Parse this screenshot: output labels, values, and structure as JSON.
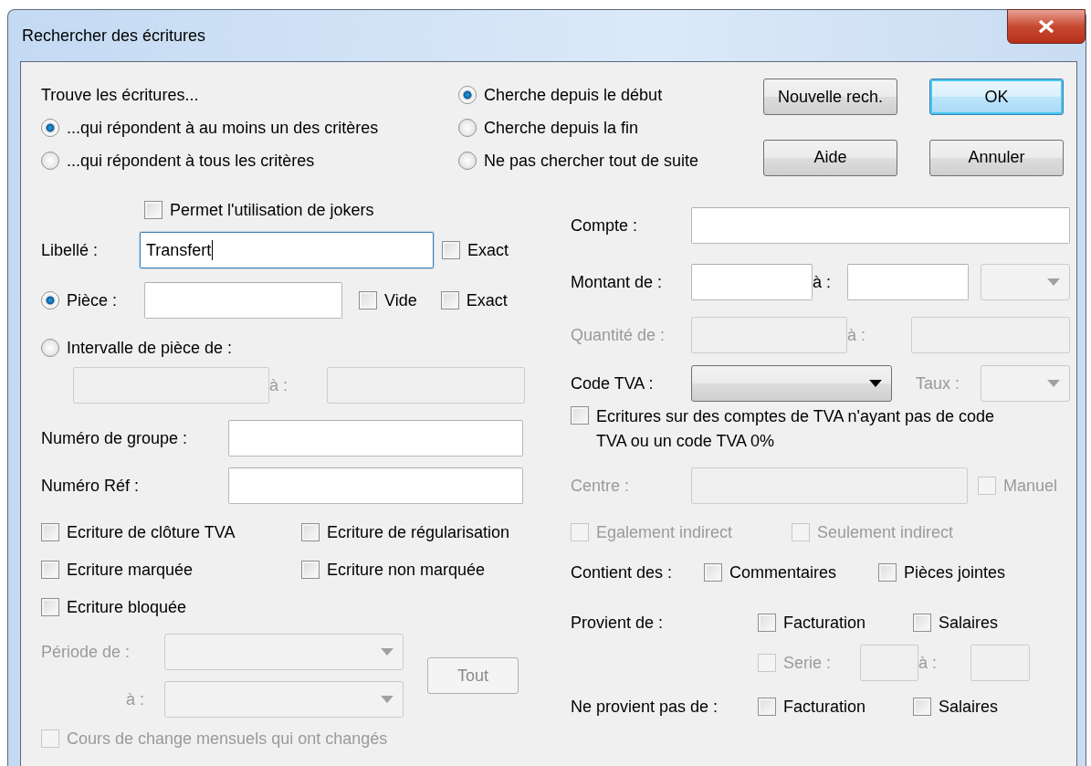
{
  "window": {
    "title": "Rechercher des écritures"
  },
  "scope": {
    "label": "Trouve les écritures...",
    "options": [
      {
        "label": "...qui répondent à au moins un des critères",
        "selected": true
      },
      {
        "label": "...qui répondent à tous les critères",
        "selected": false
      }
    ]
  },
  "direction": [
    {
      "label": "Cherche depuis le début",
      "selected": true
    },
    {
      "label": "Cherche depuis la fin",
      "selected": false
    },
    {
      "label": "Ne pas chercher tout de suite",
      "selected": false
    }
  ],
  "buttons": [
    {
      "label": "Nouvelle rech.",
      "default": false
    },
    {
      "label": "OK",
      "default": true
    },
    {
      "label": "Aide",
      "default": false
    },
    {
      "label": "Annuler",
      "default": false
    }
  ],
  "jokers": {
    "label": "Permet l'utilisation de jokers",
    "checked": false
  },
  "libelle": {
    "label": "Libellé :",
    "value": "Transfert",
    "focused": true,
    "exact": {
      "label": "Exact",
      "checked": false
    }
  },
  "piece": {
    "label": "Pièce :",
    "selected": true,
    "empty": {
      "label": "Vide",
      "checked": false
    },
    "exact": {
      "label": "Exact",
      "checked": false
    }
  },
  "interval": {
    "label": "Intervalle de pièce de :",
    "selected": false,
    "to_label": "à :",
    "disabled": true
  },
  "group_number": {
    "label": "Numéro de groupe :"
  },
  "ref_number": {
    "label": "Numéro Réf :"
  },
  "flags": [
    {
      "label": "Ecriture de clôture TVA",
      "checked": false
    },
    {
      "label": "Ecriture de régularisation",
      "checked": false
    },
    {
      "label": "Ecriture marquée",
      "checked": false
    },
    {
      "label": "Ecriture non marquée",
      "checked": false
    },
    {
      "label": "Ecriture bloquée",
      "checked": false
    }
  ],
  "period": {
    "label": "Période de :",
    "to_label": "à :",
    "button": "Tout",
    "disabled": true
  },
  "exchange_rates": {
    "label": "Cours de change mensuels qui ont changés",
    "checked": false,
    "disabled": true
  },
  "account": {
    "label": "Compte :"
  },
  "amount": {
    "label": "Montant de :",
    "to_label": "à :",
    "currency_disabled": true
  },
  "quantity": {
    "label": "Quantité de :",
    "to_label": "à :",
    "disabled": true
  },
  "vat_code": {
    "label": "Code TVA :"
  },
  "vat_rate": {
    "label": "Taux :",
    "disabled": true
  },
  "vat_accounts": {
    "label": "Ecritures sur des comptes de TVA n'ayant pas de code TVA ou un code TVA 0%",
    "checked": false
  },
  "centre": {
    "label": "Centre :",
    "disabled": true,
    "manual": {
      "label": "Manuel",
      "checked": false,
      "disabled": true
    }
  },
  "indirect": [
    {
      "label": "Egalement indirect",
      "checked": false,
      "disabled": true
    },
    {
      "label": "Seulement indirect",
      "checked": false,
      "disabled": true
    }
  ],
  "contains": {
    "label": "Contient des :",
    "options": [
      {
        "label": "Commentaires",
        "checked": false
      },
      {
        "label": "Pièces jointes",
        "checked": false
      }
    ]
  },
  "comes_from": {
    "label": "Provient de :",
    "options": [
      {
        "label": "Facturation",
        "checked": false
      },
      {
        "label": "Salaires",
        "checked": false
      }
    ],
    "series": {
      "label": "Serie :",
      "to_label": "à :",
      "checked": false,
      "disabled": true
    }
  },
  "not_from": {
    "label": "Ne provient pas de :",
    "options": [
      {
        "label": "Facturation",
        "checked": false
      },
      {
        "label": "Salaires",
        "checked": false
      }
    ]
  }
}
